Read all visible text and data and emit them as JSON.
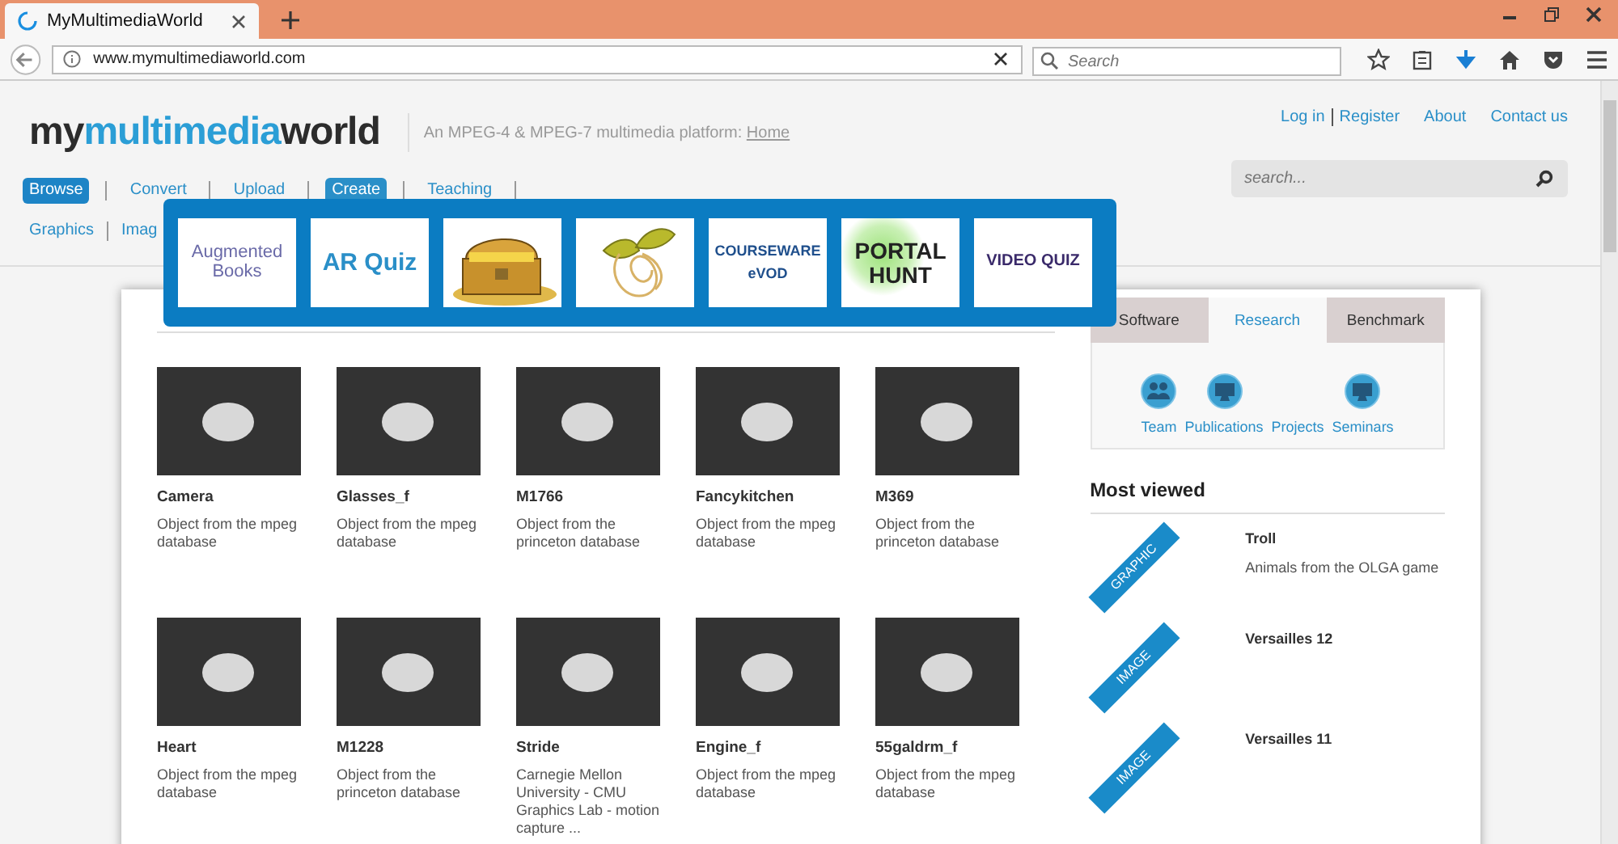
{
  "browser": {
    "tab_title": "MyMultimediaWorld",
    "url": "www.mymultimediaworld.com",
    "search_placeholder": "Search"
  },
  "header": {
    "logo": [
      {
        "text": "my",
        "kind": "dark"
      },
      {
        "text": "multimedia",
        "kind": "accent"
      },
      {
        "text": "world",
        "kind": "dark"
      }
    ],
    "tagline": "An MPEG-4 & MPEG-7 multimedia platform:",
    "tagline_link": "Home",
    "top_links": [
      {
        "label": "Log in",
        "kind": "joined"
      },
      {
        "label": "Register",
        "kind": "plain"
      },
      {
        "label": "About",
        "kind": "plain"
      },
      {
        "label": "Contact us",
        "kind": "plain"
      }
    ],
    "search_placeholder": "search..."
  },
  "nav": [
    {
      "label": "Browse",
      "selected": true,
      "expanded": false
    },
    {
      "label": "Convert",
      "selected": false,
      "expanded": false
    },
    {
      "label": "Upload",
      "selected": false,
      "expanded": false
    },
    {
      "label": "Create",
      "selected": false,
      "expanded": true
    },
    {
      "label": "Teaching",
      "selected": false,
      "expanded": false
    }
  ],
  "subnav": [
    "Graphics",
    "Imag"
  ],
  "create_menu": [
    {
      "kind": "augmented",
      "lines": [
        "Augmented",
        "Books"
      ]
    },
    {
      "kind": "arquiz",
      "lines": [
        "AR Quiz"
      ]
    },
    {
      "kind": "chest"
    },
    {
      "kind": "plant"
    },
    {
      "kind": "courseware",
      "lines": [
        "COURSEWARE",
        "eVOD"
      ]
    },
    {
      "kind": "portal",
      "lines": [
        "PORTAL",
        "HUNT"
      ]
    },
    {
      "kind": "videoquiz",
      "lines": [
        "VIDEO QUIZ"
      ]
    }
  ],
  "objects": [
    {
      "name": "Camera",
      "description": "Object from the mpeg database"
    },
    {
      "name": "Glasses_f",
      "description": "Object from the mpeg database"
    },
    {
      "name": "M1766",
      "description": "Object from the princeton database"
    },
    {
      "name": "Fancykitchen",
      "description": "Object from the mpeg database"
    },
    {
      "name": "M369",
      "description": "Object from the princeton database"
    },
    {
      "name": "Heart",
      "description": "Object from the mpeg database"
    },
    {
      "name": "M1228",
      "description": "Object from the princeton database"
    },
    {
      "name": "Stride",
      "description": "Carnegie Mellon University - CMU Graphics Lab - motion capture ..."
    },
    {
      "name": "Engine_f",
      "description": "Object from the mpeg database"
    },
    {
      "name": "55galdrm_f",
      "description": "Object from the mpeg database"
    }
  ],
  "side_tabs": [
    {
      "label": "Software",
      "selected": false
    },
    {
      "label": "Research",
      "selected": true
    },
    {
      "label": "Benchmark",
      "selected": false
    }
  ],
  "research_links": [
    {
      "label": "Team",
      "kind": "people"
    },
    {
      "label": "Publications",
      "kind": "screen"
    },
    {
      "label": "Projects",
      "kind": "none"
    },
    {
      "label": "Seminars",
      "kind": "screen"
    }
  ],
  "most_viewed": {
    "title": "Most viewed",
    "items": [
      {
        "tag": "GRAPHIC",
        "title": "Troll",
        "description": "Animals from the OLGA game"
      },
      {
        "tag": "IMAGE",
        "title": "Versailles 12"
      },
      {
        "tag": "IMAGE",
        "title": "Versailles 11"
      }
    ]
  }
}
